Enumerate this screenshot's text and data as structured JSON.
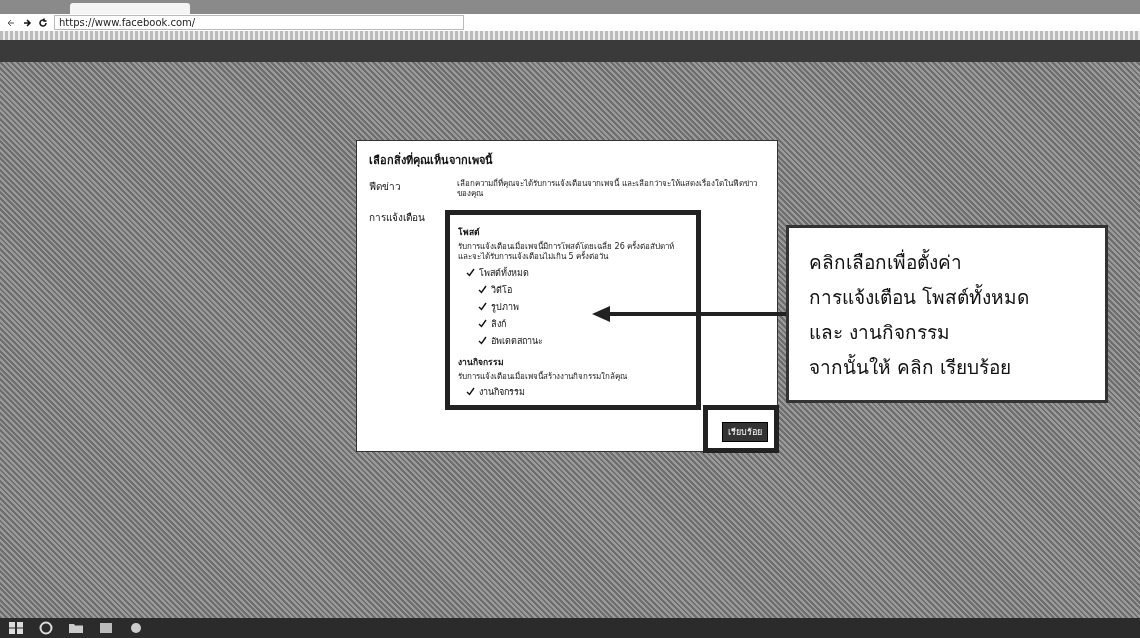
{
  "browser": {
    "url": "https://www.facebook.com/"
  },
  "dialog": {
    "title": "เลือกสิ่งที่คุณเห็นจากเพจนี้",
    "feed": {
      "label": "ฟีดข่าว",
      "description": "เลือกความถี่ที่คุณจะได้รับการแจ้งเตือนจากเพจนี้ และเลือกว่าจะให้แสดงเรื่องใดในฟีดข่าวของคุณ"
    },
    "notifications": {
      "label": "การแจ้งเตือน",
      "groups": [
        {
          "title": "โพสต์",
          "description": "รับการแจ้งเตือนเมื่อเพจนี้มีการโพสต์โดยเฉลี่ย 26 ครั้งต่อสัปดาห์ และจะได้รับการแจ้งเตือนไม่เกิน 5 ครั้งต่อวัน",
          "options": [
            {
              "label": "โพสต์ทั้งหมด",
              "checked": true,
              "children": [
                {
                  "label": "วิดีโอ",
                  "checked": true
                },
                {
                  "label": "รูปภาพ",
                  "checked": true
                },
                {
                  "label": "ลิงก์",
                  "checked": true
                },
                {
                  "label": "อัพเดตสถานะ",
                  "checked": true
                }
              ]
            }
          ]
        },
        {
          "title": "งานกิจกรรม",
          "description": "รับการแจ้งเตือนเมื่อเพจนี้สร้างงานกิจกรรมใกล้คุณ",
          "options": [
            {
              "label": "งานกิจกรรม",
              "checked": true
            }
          ]
        }
      ]
    },
    "button": "เรียบร้อย"
  },
  "callout": {
    "lines": [
      "คลิกเลือกเพื่อตั้งค่า",
      "การแจ้งเตือน โพสต์ทั้งหมด",
      "และ งานกิจกรรม",
      "จากนั้นให้ คลิก เรียบร้อย"
    ]
  }
}
